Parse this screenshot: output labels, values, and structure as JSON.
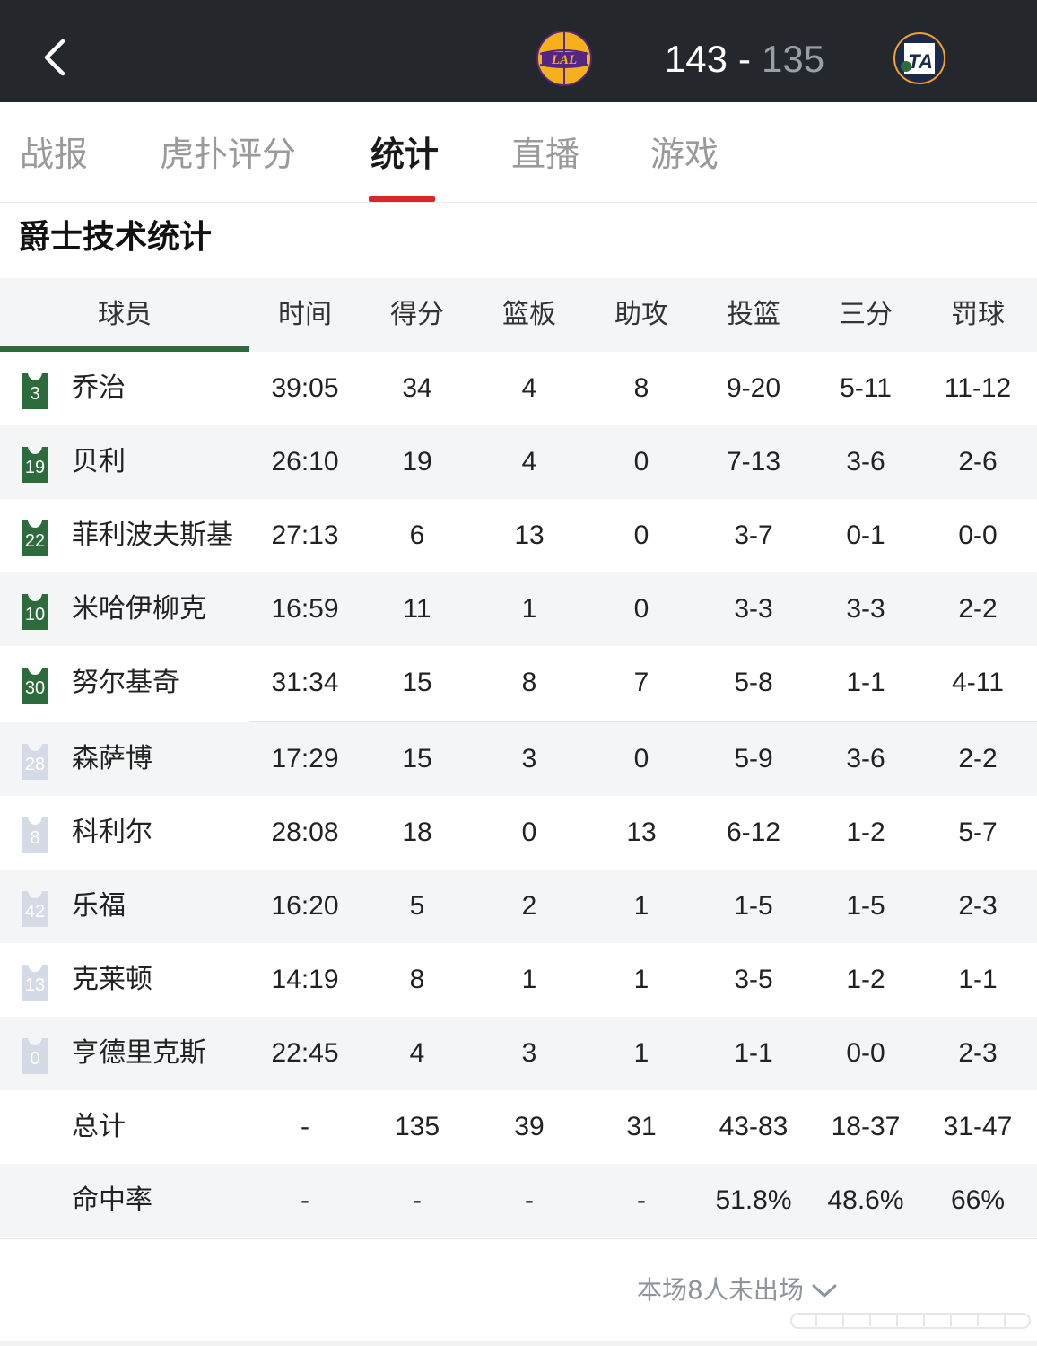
{
  "header": {
    "home_score": "143",
    "away_score": "135",
    "dash": "-",
    "home_team_logo": "LAL",
    "away_team_logo": "UTA"
  },
  "tabs": [
    {
      "label": "战报"
    },
    {
      "label": "虎扑评分"
    },
    {
      "label": "统计",
      "active": true
    },
    {
      "label": "直播"
    },
    {
      "label": "游戏"
    }
  ],
  "section_title": "爵士技术统计",
  "table": {
    "columns": [
      "球员",
      "时间",
      "得分",
      "篮板",
      "助攻",
      "投篮",
      "三分",
      "罚球"
    ],
    "starters": [
      {
        "number": "3",
        "name": "乔治",
        "min": "39:05",
        "pts": "34",
        "reb": "4",
        "ast": "8",
        "fg": "9-20",
        "three": "5-11",
        "ft": "11-12"
      },
      {
        "number": "19",
        "name": "贝利",
        "min": "26:10",
        "pts": "19",
        "reb": "4",
        "ast": "0",
        "fg": "7-13",
        "three": "3-6",
        "ft": "2-6"
      },
      {
        "number": "22",
        "name": "菲利波夫斯基",
        "min": "27:13",
        "pts": "6",
        "reb": "13",
        "ast": "0",
        "fg": "3-7",
        "three": "0-1",
        "ft": "0-0"
      },
      {
        "number": "10",
        "name": "米哈伊柳克",
        "min": "16:59",
        "pts": "11",
        "reb": "1",
        "ast": "0",
        "fg": "3-3",
        "three": "3-3",
        "ft": "2-2"
      },
      {
        "number": "30",
        "name": "努尔基奇",
        "min": "31:34",
        "pts": "15",
        "reb": "8",
        "ast": "7",
        "fg": "5-8",
        "three": "1-1",
        "ft": "4-11"
      }
    ],
    "bench": [
      {
        "number": "28",
        "name": "森萨博",
        "min": "17:29",
        "pts": "15",
        "reb": "3",
        "ast": "0",
        "fg": "5-9",
        "three": "3-6",
        "ft": "2-2"
      },
      {
        "number": "8",
        "name": "科利尔",
        "min": "28:08",
        "pts": "18",
        "reb": "0",
        "ast": "13",
        "fg": "6-12",
        "three": "1-2",
        "ft": "5-7"
      },
      {
        "number": "42",
        "name": "乐福",
        "min": "16:20",
        "pts": "5",
        "reb": "2",
        "ast": "1",
        "fg": "1-5",
        "three": "1-5",
        "ft": "2-3"
      },
      {
        "number": "13",
        "name": "克莱顿",
        "min": "14:19",
        "pts": "8",
        "reb": "1",
        "ast": "1",
        "fg": "3-5",
        "three": "1-2",
        "ft": "1-1"
      },
      {
        "number": "0",
        "name": "亨德里克斯",
        "min": "22:45",
        "pts": "4",
        "reb": "3",
        "ast": "1",
        "fg": "1-1",
        "three": "0-0",
        "ft": "2-3"
      }
    ],
    "totals": {
      "label": "总计",
      "min": "-",
      "pts": "135",
      "reb": "39",
      "ast": "31",
      "fg": "43-83",
      "three": "18-37",
      "ft": "31-47"
    },
    "percent": {
      "label": "命中率",
      "min": "-",
      "pts": "-",
      "reb": "-",
      "ast": "-",
      "fg": "51.8%",
      "three": "48.6%",
      "ft": "66%"
    }
  },
  "dnp_text": "本场8人未出场",
  "colors": {
    "topbar": "#24272b",
    "accent_red": "#d9262b",
    "starter_green": "#2e6b3c",
    "bench_jersey": "#d5dbe6"
  }
}
